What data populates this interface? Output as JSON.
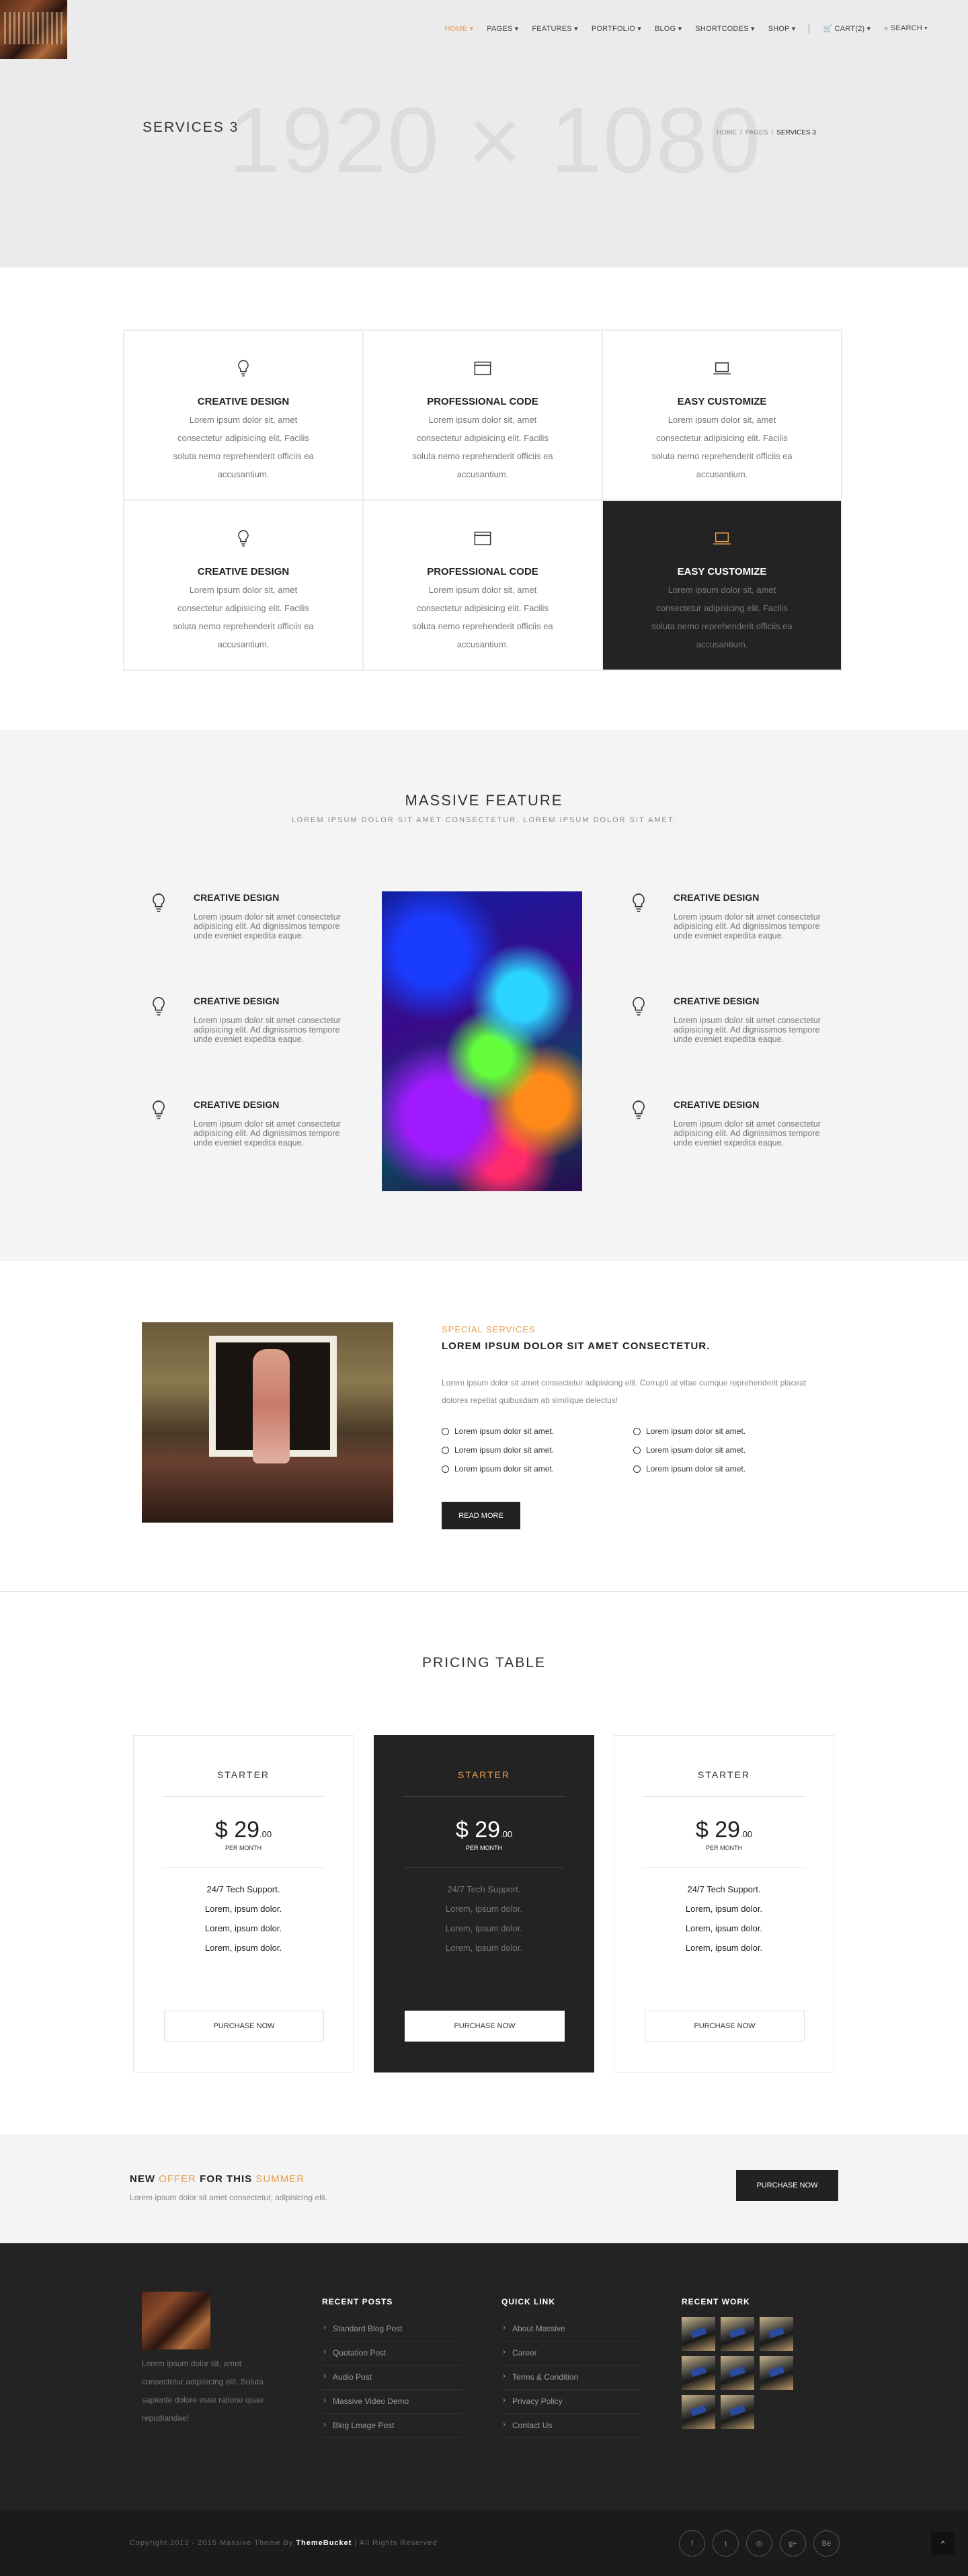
{
  "header": {
    "nav": [
      {
        "label": "HOME ▾",
        "active": true
      },
      {
        "label": "PAGES ▾"
      },
      {
        "label": "FEATURES ▾"
      },
      {
        "label": "PORTFOLIO ▾"
      },
      {
        "label": "BLOG ▾"
      },
      {
        "label": "SHORTCODES ▾"
      },
      {
        "label": "SHOP ▾"
      },
      {
        "label": "CART(2) ▾"
      },
      {
        "label": "SEARCH ▾"
      }
    ]
  },
  "hero": {
    "placeholder_text": "1920 × 1080",
    "title": "SERVICES 3",
    "breadcrumb": [
      "HOME",
      "PAGES",
      "SERVICES 3"
    ]
  },
  "services": [
    {
      "icon": "lightbulb-icon",
      "title": "CREATIVE DESIGN",
      "text": "Lorem ipsum dolor sit, amet consectetur adipisicing elit. Facilis soluta nemo reprehenderit officiis ea accusantium."
    },
    {
      "icon": "browser-window-icon",
      "title": "PROFESSIONAL CODE",
      "text": "Lorem ipsum dolor sit, amet consectetur adipisicing elit. Facilis soluta nemo reprehenderit officiis ea accusantium."
    },
    {
      "icon": "laptop-icon",
      "title": "EASY CUSTOMIZE",
      "text": "Lorem ipsum dolor sit, amet consectetur adipisicing elit. Facilis soluta nemo reprehenderit officiis ea accusantium."
    },
    {
      "icon": "lightbulb-icon",
      "title": "CREATIVE DESIGN",
      "text": "Lorem ipsum dolor sit, amet consectetur adipisicing elit. Facilis soluta nemo reprehenderit officiis ea accusantium."
    },
    {
      "icon": "browser-window-icon",
      "title": "PROFESSIONAL CODE",
      "text": "Lorem ipsum dolor sit, amet consectetur adipisicing elit. Facilis soluta nemo reprehenderit officiis ea accusantium."
    },
    {
      "icon": "laptop-icon",
      "title": "EASY CUSTOMIZE",
      "text": "Lorem ipsum dolor sit, amet consectetur adipisicing elit. Facilis soluta nemo reprehenderit officiis ea accusantium."
    }
  ],
  "feature": {
    "title": "MASSIVE FEATURE",
    "subtitle": "LOREM IPSUM DOLOR SIT AMET CONSECTETUR. LOREM IPSUM DOLOR SIT AMET.",
    "items": [
      {
        "title": "CREATIVE DESIGN",
        "text": "Lorem ipsum dolor sit amet consectetur adipisicing elit. Ad dignissimos tempore unde eveniet expedita eaque."
      },
      {
        "title": "CREATIVE DESIGN",
        "text": "Lorem ipsum dolor sit amet consectetur adipisicing elit. Ad dignissimos tempore unde eveniet expedita eaque."
      },
      {
        "title": "CREATIVE DESIGN",
        "text": "Lorem ipsum dolor sit amet consectetur adipisicing elit. Ad dignissimos tempore unde eveniet expedita eaque."
      },
      {
        "title": "CREATIVE DESIGN",
        "text": "Lorem ipsum dolor sit amet consectetur adipisicing elit. Ad dignissimos tempore unde eveniet expedita eaque."
      },
      {
        "title": "CREATIVE DESIGN",
        "text": "Lorem ipsum dolor sit amet consectetur adipisicing elit. Ad dignissimos tempore unde eveniet expedita eaque."
      },
      {
        "title": "CREATIVE DESIGN",
        "text": "Lorem ipsum dolor sit amet consectetur adipisicing elit. Ad dignissimos tempore unde eveniet expedita eaque."
      }
    ]
  },
  "special": {
    "kicker": "SPECIAL SERVICES",
    "title": "LOREM IPSUM DOLOR SIT AMET CONSECTETUR.",
    "desc": "Lorem ipsum dolor sit amet consectetur adipisicing elit. Corrupti at vitae cumque reprehenderit placeat dolores repellat quibusdam ab similique delectus!",
    "list": [
      "Lorem ipsum dolor sit amet.",
      "Lorem ipsum dolor sit amet.",
      "Lorem ipsum dolor sit amet.",
      "Lorem ipsum dolor sit amet.",
      "Lorem ipsum dolor sit amet.",
      "Lorem ipsum dolor sit amet."
    ],
    "button": "READ MORE"
  },
  "pricing": {
    "title": "PRICING TABLE",
    "cards": [
      {
        "plan": "STARTER",
        "currency": "$",
        "amount": "29",
        "cents": ".00",
        "period": "PER MONTH",
        "features": [
          "24/7 Tech Support.",
          "Lorem, ipsum dolor.",
          "Lorem, ipsum dolor.",
          "Lorem, ipsum dolor."
        ],
        "button": "PURCHASE NOW"
      },
      {
        "plan": "STARTER",
        "currency": "$",
        "amount": "29",
        "cents": ".00",
        "period": "PER MONTH",
        "features": [
          "24/7 Tech Support.",
          "Lorem, ipsum dolor.",
          "Lorem, ipsum dolor.",
          "Lorem, ipsum dolor."
        ],
        "button": "PURCHASE NOW"
      },
      {
        "plan": "STARTER",
        "currency": "$",
        "amount": "29",
        "cents": ".00",
        "period": "PER MONTH",
        "features": [
          "24/7 Tech Support.",
          "Lorem, ipsum dolor.",
          "Lorem, ipsum dolor.",
          "Lorem, ipsum dolor."
        ],
        "button": "PURCHASE NOW"
      }
    ]
  },
  "offer": {
    "pre": "NEW ",
    "accent1": "OFFER",
    "mid": " FOR THIS ",
    "accent2": "SUMMER",
    "sub": "Lorem ipsum dolor sit amet consectetur, adipisicing elit.",
    "button": "PURCHASE NOW"
  },
  "footer": {
    "about": "Lorem ipsum dolor sit, amet consectetur adipisicing elit. Soluta sapiente dolore esse ratione quae repudiandae!",
    "recent_posts_title": "RECENT POSTS",
    "recent_posts": [
      "Standard Blog Post",
      "Quotation Post",
      "Audio Post",
      "Massive Video Demo",
      "Blog Lmage Post"
    ],
    "quick_link_title": "QUICK LINK",
    "quick_links": [
      "About Massive",
      "Career",
      "Terms & Condition",
      "Privacy Policy",
      "Contact Us"
    ],
    "recent_work_title": "RECENT WORK",
    "copyright_pre": "Copyright 2012 - 2015 Massive Theme By ",
    "copyright_brand": "ThemeBucket",
    "copyright_post": " | All Rights Reserved",
    "socials": [
      "f",
      "t",
      "◎",
      "g+",
      "Bē"
    ],
    "to_top": "^"
  },
  "colors": {
    "accent": "#e79f4f",
    "dark": "#232323"
  }
}
